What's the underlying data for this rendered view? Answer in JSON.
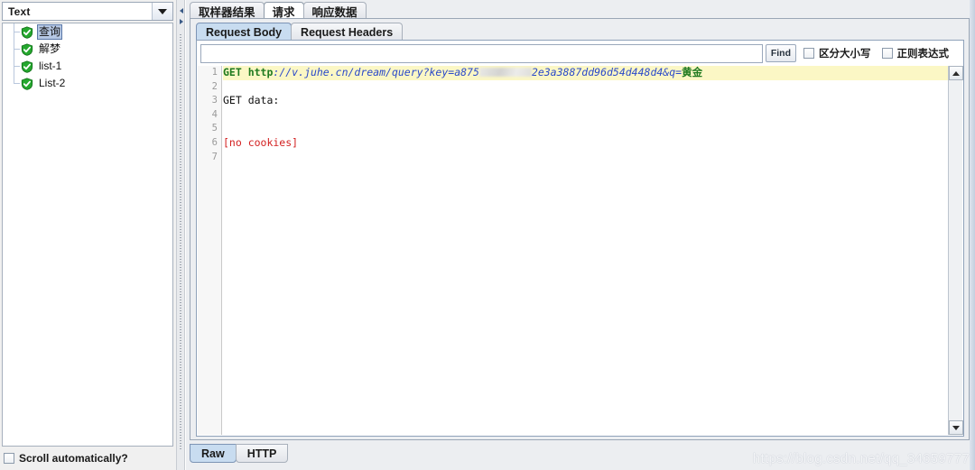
{
  "left_panel": {
    "type_combo": {
      "value": "Text",
      "arrow_icon": "chevron-down-icon"
    },
    "tree_items": [
      {
        "label": "查询",
        "icon": "green-shield-check-icon",
        "selected": true
      },
      {
        "label": "解梦",
        "icon": "green-shield-check-icon",
        "selected": false
      },
      {
        "label": "list-1",
        "icon": "green-shield-check-icon",
        "selected": false
      },
      {
        "label": "List-2",
        "icon": "green-shield-check-icon",
        "selected": false
      }
    ],
    "scroll_auto": {
      "label": "Scroll automatically?",
      "checked": false
    }
  },
  "divider": {
    "collapse_left_icon": "triangle-left-icon",
    "collapse_right_icon": "triangle-right-icon"
  },
  "right_panel": {
    "outer_tabs": [
      {
        "label": "取样器结果",
        "selected": false
      },
      {
        "label": "请求",
        "selected": true
      },
      {
        "label": "响应数据",
        "selected": false
      }
    ],
    "inner_tabs": [
      {
        "label": "Request Body",
        "selected": true
      },
      {
        "label": "Request Headers",
        "selected": false
      }
    ],
    "find_bar": {
      "input_value": "",
      "input_placeholder": "",
      "find_label": "Find",
      "case_sensitive": {
        "label": "区分大小写",
        "checked": false
      },
      "regex": {
        "label": "正则表达式",
        "checked": false
      }
    },
    "code": {
      "line_numbers": [
        "1",
        "2",
        "3",
        "4",
        "5",
        "6",
        "7"
      ],
      "lines": [
        {
          "n": "1",
          "highlighted": true,
          "tokens": [
            {
              "text": "GET ",
              "style": "kw"
            },
            {
              "text": "http",
              "style": "kw"
            },
            {
              "text": "://v.juhe.cn/dream/query?key=",
              "style": "url"
            },
            {
              "text": "a875",
              "style": "url"
            },
            {
              "text": "",
              "style": "redact"
            },
            {
              "text": "2e3a3887dd96d54d448d4&q=",
              "style": "url"
            },
            {
              "text": "黄金",
              "style": "cjk"
            }
          ]
        },
        {
          "n": "2",
          "highlighted": false,
          "tokens": []
        },
        {
          "n": "3",
          "highlighted": false,
          "tokens": [
            {
              "text": "GET data:",
              "style": "plain"
            }
          ]
        },
        {
          "n": "4",
          "highlighted": false,
          "tokens": []
        },
        {
          "n": "5",
          "highlighted": false,
          "tokens": []
        },
        {
          "n": "6",
          "highlighted": false,
          "tokens": [
            {
              "text": "[no cookies]",
              "style": "err"
            }
          ]
        },
        {
          "n": "7",
          "highlighted": false,
          "tokens": []
        }
      ]
    },
    "code_scrollbar": {
      "up_icon": "triangle-up-icon",
      "down_icon": "triangle-down-icon"
    },
    "bottom_tabs": [
      {
        "label": "Raw",
        "selected": true
      },
      {
        "label": "HTTP",
        "selected": false
      }
    ]
  },
  "watermark": {
    "text": "https://blog.csdn.net/qq_34659777"
  },
  "colors": {
    "highlight_line": "#fbf7c5",
    "tab_selected": "#c8dcf0",
    "tree_selection": "#b6c8e4",
    "shield_green": "#1f9e2a",
    "url_blue": "#2a49c9",
    "keyword_green": "#1f7a1f",
    "error_red": "#d32020"
  }
}
